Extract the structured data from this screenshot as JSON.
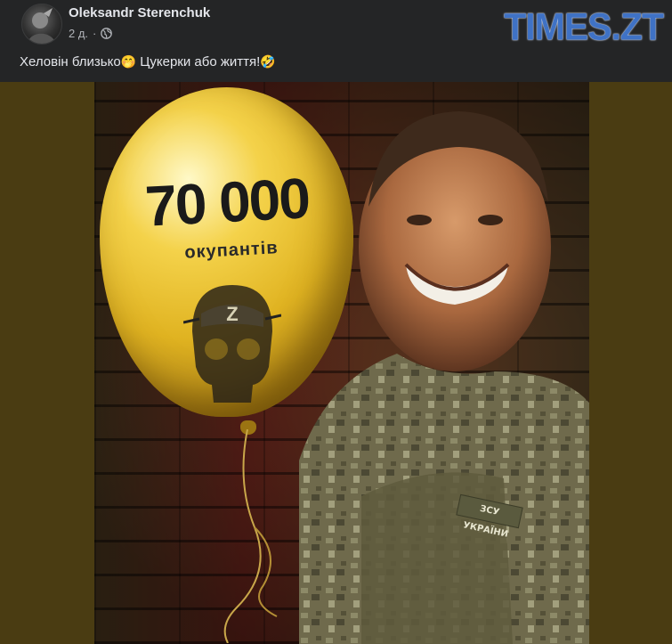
{
  "post": {
    "author": "Oleksandr Sterenchuk",
    "time": "2 д.",
    "privacy_icon": "globe-icon",
    "text": "Хеловін близько",
    "text_emoji_1": "🤭",
    "text_2": " Цукерки або життя!",
    "text_emoji_2": "🤣"
  },
  "watermark": {
    "logo": "TIMES.ZT"
  },
  "image": {
    "balloon_number": "70 000",
    "balloon_caption": "окупантів",
    "skull_letter": "Z",
    "patch_text": "ЗСУ УКРАЇНИ"
  },
  "colors": {
    "background": "#242526",
    "logo": "#3f72c5",
    "balloon": "#e0b321"
  }
}
